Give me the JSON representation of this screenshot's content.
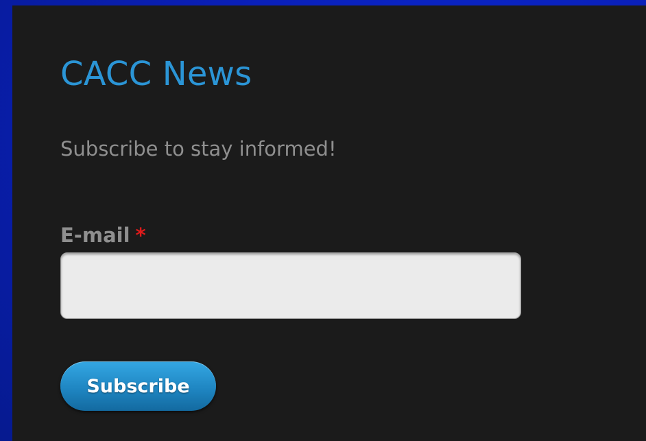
{
  "block": {
    "title": "CACC News",
    "subtitle": "Subscribe to stay informed!"
  },
  "form": {
    "email_label": "E-mail",
    "required_marker": "*",
    "email_value": "",
    "email_placeholder": "",
    "submit_label": "Subscribe"
  },
  "colors": {
    "title": "#2b95d6",
    "panel_background": "#1b1b1b",
    "text_muted": "#8f8f8f",
    "required": "#e01b1b",
    "button": "#1f86c2",
    "page_background": "#0a1fb8"
  }
}
